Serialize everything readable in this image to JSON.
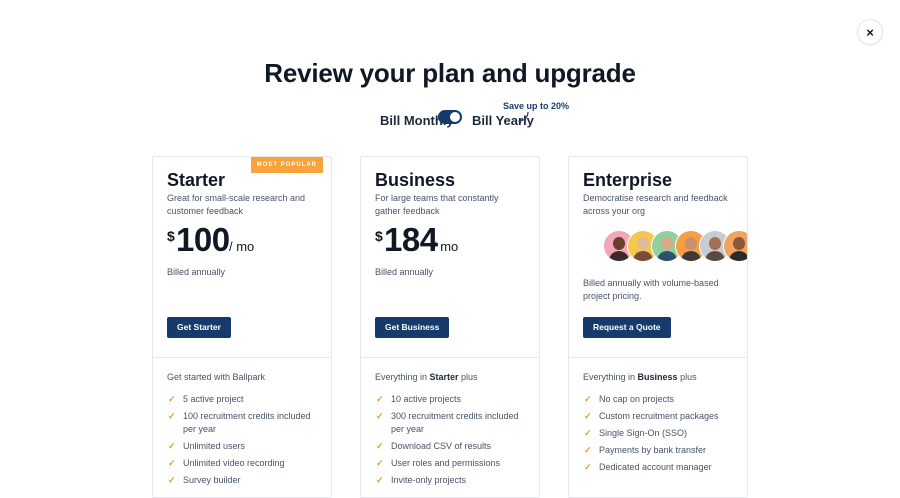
{
  "close_label": "×",
  "title": "Review your plan and upgrade",
  "billing": {
    "monthly_label": "Bill Monthly",
    "yearly_label": "Bill Yearly",
    "save_note": "Save up to 20%",
    "selected": "yearly"
  },
  "colors": {
    "accent": "#173a6c",
    "badge": "#f7a23b",
    "check": "#f7931e"
  },
  "plans": [
    {
      "badge": "MOST POPULAR",
      "name": "Starter",
      "description": "Great for small-scale research and customer feedback",
      "currency": "$",
      "price": "100",
      "period": "/ mo",
      "billed": "Billed annually",
      "cta": "Get Starter",
      "features_head": "Get started with Ballpark",
      "features": [
        "5 active project",
        "100 recruitment credits included per year",
        "Unlimited users",
        "Unlimited video recording",
        "Survey builder"
      ]
    },
    {
      "name": "Business",
      "description": "For large teams that constantly gather feedback",
      "currency": "$",
      "price": "184",
      "period": "/ mo",
      "billed": "Billed annually",
      "cta": "Get Business",
      "features_head_pre": "Everything in ",
      "features_head_bold": "Starter",
      "features_head_post": " plus",
      "features": [
        "10 active projects",
        "300 recruitment credits included per year",
        "Download CSV of results",
        "User roles and permissions",
        "Invite-only projects"
      ]
    },
    {
      "name": "Enterprise",
      "description": "Democratise research and feedback across your org",
      "billed": "Billed annually with volume-based project pricing.",
      "cta": "Request a Quote",
      "features_head_pre": "Everything in ",
      "features_head_bold": "Business",
      "features_head_post": " plus",
      "features": [
        "No cap on projects",
        "Custom recruitment packages",
        "Single Sign-On (SSO)",
        "Payments by bank transfer",
        "Dedicated account manager"
      ]
    }
  ],
  "check_glyph": "✓",
  "avatar_icons": [
    "person-avatar",
    "person-avatar",
    "person-avatar",
    "person-avatar",
    "person-avatar",
    "person-avatar"
  ]
}
